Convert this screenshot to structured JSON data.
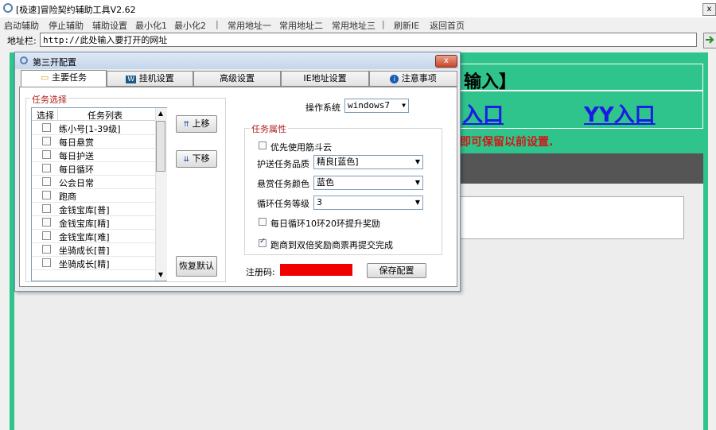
{
  "window": {
    "title": "[极速]冒险契约辅助工具V2.62",
    "close_glyph": "x"
  },
  "menu": [
    "启动辅助",
    "停止辅助",
    "辅助设置",
    "最小化1",
    "最小化2",
    "常用地址一",
    "常用地址二",
    "常用地址三",
    "刷新IE",
    "返回首页"
  ],
  "address_bar": {
    "label": "地址栏:",
    "value": "http://此处输入要打开的网址"
  },
  "web": {
    "header_text": "输入】",
    "link_1": "入口",
    "link_2": "YY入口",
    "notice": "即可保留以前设置."
  },
  "dialog": {
    "title": "第三开配置",
    "close_glyph": "x",
    "tabs": [
      "主要任务",
      "挂机设置",
      "高级设置",
      "IE地址设置",
      "注意事项"
    ],
    "task_group_label": "任务选择",
    "list_headers": [
      "选择",
      "任务列表"
    ],
    "tasks": [
      "练小号[1-39级]",
      "每日悬赏",
      "每日护送",
      "每日循环",
      "公会日常",
      "跑商",
      "金钱宝库[普]",
      "金钱宝库[精]",
      "金钱宝库[难]",
      "坐骑成长[普]",
      "坐骑成长[精]"
    ],
    "btn_up": "上移",
    "btn_down": "下移",
    "btn_reset": "恢复默认",
    "os_label": "操作系统",
    "os_value": "windows7",
    "props_label": "任务属性",
    "opt_jindou": "优先使用筋斗云",
    "escort_label": "护送任务品质",
    "escort_value": "精良[蓝色]",
    "bounty_label": "悬赏任务颜色",
    "bounty_value": "蓝色",
    "loop_label": "循环任务等级",
    "loop_value": "3",
    "opt_daily": "每日循环10环20环提升奖励",
    "opt_paoshang": "跑商到双倍奖励商票再提交完成",
    "reg_label": "注册码:",
    "btn_save": "保存配置",
    "checked": {
      "jindou": false,
      "daily": false,
      "paoshang": true
    },
    "colors": {
      "reg_field": "#f10000",
      "web_bg": "#2ec48c",
      "link": "#1a1ae6",
      "notice": "#d01818"
    }
  }
}
